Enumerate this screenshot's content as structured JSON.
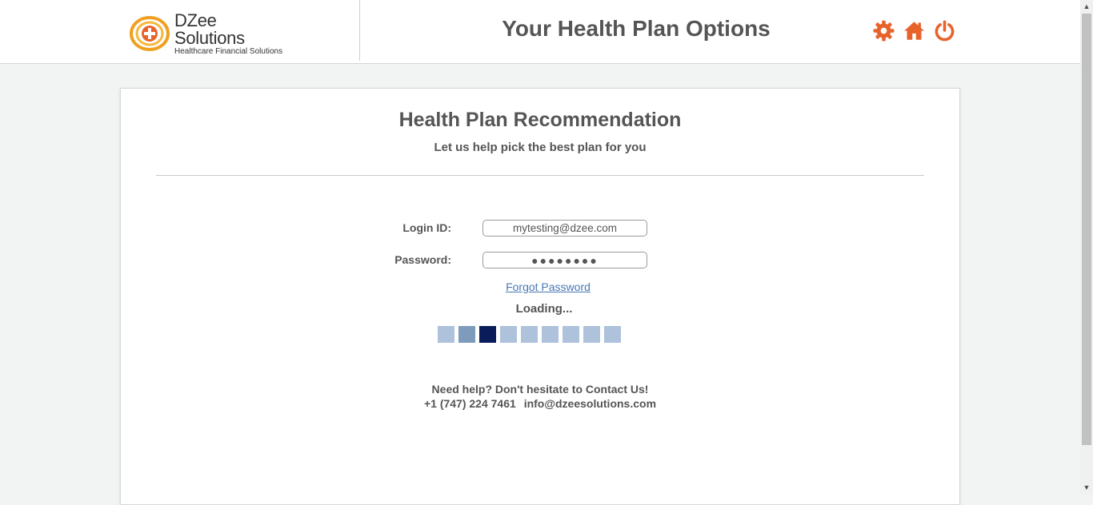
{
  "header": {
    "logo": {
      "name": "DZee Solutions",
      "tagline": "Healthcare Financial Solutions"
    },
    "title": "Your Health Plan Options",
    "icons": [
      "gear-icon",
      "home-icon",
      "power-icon"
    ],
    "accent_color": "#e8632b"
  },
  "card": {
    "title": "Health Plan Recommendation",
    "subtitle": "Let us help pick the best plan for you",
    "login": {
      "login_label": "Login ID:",
      "login_value": "mytesting@dzee.com",
      "password_label": "Password:",
      "password_value": "●●●●●●●●",
      "forgot_label": "Forgot Password"
    },
    "loading": {
      "text": "Loading...",
      "blocks": [
        "#aec2dc",
        "#7e9bbc",
        "#0b1c5b",
        "#aec2dc",
        "#aec2dc",
        "#aec2dc",
        "#aec2dc",
        "#aec2dc",
        "#aec2dc"
      ]
    },
    "help": {
      "text": "Need help? Don't hesitate to Contact Us!",
      "phone": "+1 (747) 224 7461",
      "email": "info@dzeesolutions.com"
    }
  }
}
